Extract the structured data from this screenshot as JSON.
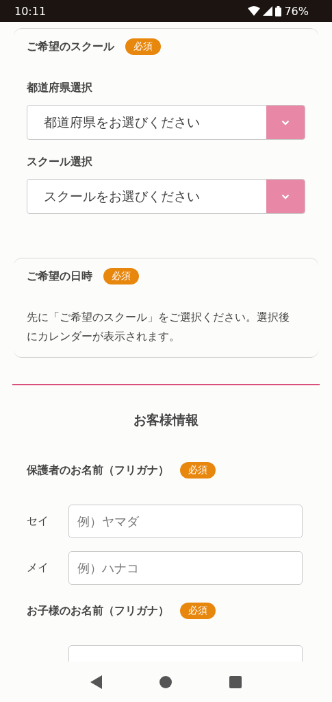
{
  "status_bar": {
    "time": "10:11",
    "battery": "76%"
  },
  "sections": [
    {
      "kind": "selects",
      "title": "ご希望のスクール",
      "badge": "必須",
      "selects": [
        {
          "label": "都道府県選択",
          "value": "都道府県をお選びください"
        },
        {
          "label": "スクール選択",
          "value": "スクールをお選びください"
        }
      ]
    },
    {
      "kind": "note",
      "title": "ご希望の日時",
      "badge": "必須",
      "text": "先に「ご希望のスクール」をご選択ください。選択後にカレンダーが表示されます。"
    },
    {
      "kind": "heading",
      "title": "お客様情報"
    },
    {
      "kind": "names",
      "title": "保護者のお名前（フリガナ）",
      "badge": "必須",
      "fields": [
        {
          "kind": "text",
          "label": "セイ",
          "placeholder": "例）ヤマダ"
        },
        {
          "kind": "text",
          "label": "メイ",
          "placeholder": "例）ハナコ"
        }
      ]
    },
    {
      "kind": "names",
      "title": "お子様のお名前（フリガナ）",
      "badge": "必須",
      "fields": [
        {
          "kind": "text"
        }
      ]
    }
  ]
}
